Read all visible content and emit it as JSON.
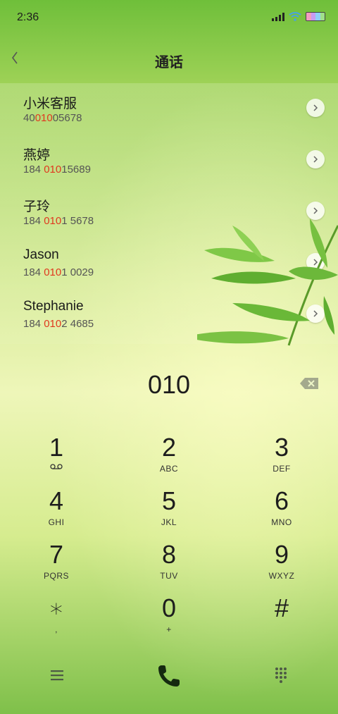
{
  "status": {
    "time": "2:36"
  },
  "header": {
    "title": "通话"
  },
  "contacts": [
    {
      "name": "小米客服",
      "phone_pre": "40",
      "phone_match": "010",
      "phone_post": "05678"
    },
    {
      "name": "燕婷",
      "phone_pre": "184 ",
      "phone_match": "010",
      "phone_post": "15689"
    },
    {
      "name": "子玲",
      "phone_pre": "184 ",
      "phone_match": "010",
      "phone_post": "1 5678"
    },
    {
      "name": "Jason",
      "phone_pre": "184 ",
      "phone_match": "010",
      "phone_post": "1 0029"
    },
    {
      "name": "Stephanie",
      "phone_pre": "184 ",
      "phone_match": "010",
      "phone_post": "2 4685"
    }
  ],
  "dialer": {
    "entered_number": "010",
    "keys": [
      {
        "digit": "1",
        "letters": ""
      },
      {
        "digit": "2",
        "letters": "ABC"
      },
      {
        "digit": "3",
        "letters": "DEF"
      },
      {
        "digit": "4",
        "letters": "GHI"
      },
      {
        "digit": "5",
        "letters": "JKL"
      },
      {
        "digit": "6",
        "letters": "MNO"
      },
      {
        "digit": "7",
        "letters": "PQRS"
      },
      {
        "digit": "8",
        "letters": "TUV"
      },
      {
        "digit": "9",
        "letters": "WXYZ"
      },
      {
        "digit": "∗",
        "letters": ","
      },
      {
        "digit": "0",
        "letters": "+"
      },
      {
        "digit": "#",
        "letters": ""
      }
    ]
  },
  "icons": {
    "back": "chevron-left-icon",
    "detail": "chevron-right-icon",
    "backspace": "backspace-icon",
    "voicemail": "voicemail-icon",
    "menu": "menu-icon",
    "call": "phone-icon",
    "keypad": "keypad-icon"
  },
  "colors": {
    "highlight": "#e0391f"
  }
}
